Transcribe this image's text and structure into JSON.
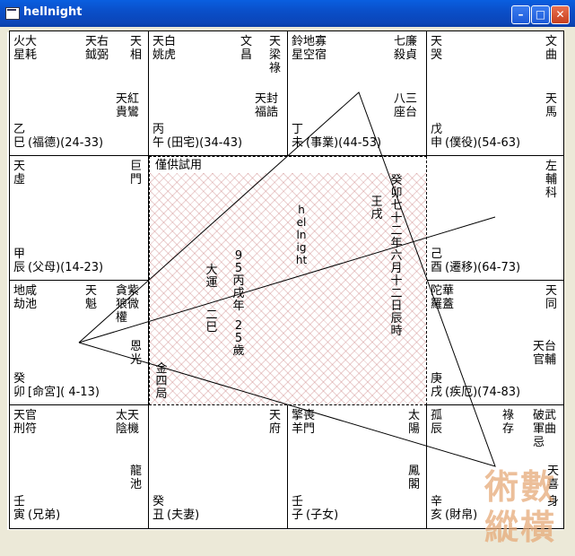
{
  "window": {
    "title": "hellnight"
  },
  "cells": [
    {
      "stars_a": "火大",
      "stars_b": "星耗",
      "stars_c": "天右",
      "stars_d": "鉞弼",
      "stars_e": "天",
      "stars_f": "相",
      "mid": "天紅\n貴鸞",
      "stem": "乙",
      "branch": "巳",
      "label": "(福德)(24-33)"
    },
    {
      "stars_a": "天白",
      "stars_b": "姚虎",
      "stars_c": "文",
      "stars_d": "昌",
      "stars_e": "天",
      "stars_f": "梁\n祿",
      "mid": "天封\n福誥",
      "stem": "丙",
      "branch": "午",
      "label": "(田宅)(34-43)"
    },
    {
      "stars_a": "鈴地寡",
      "stars_b": "星空宿",
      "stars_c": "七廉",
      "stars_d": "殺貞",
      "mid": "八三\n座台",
      "stem": "丁",
      "branch": "未",
      "label": "(事業)(44-53)"
    },
    {
      "stars_a": "天",
      "stars_b": "哭",
      "stars_c": "文",
      "stars_d": "曲",
      "mid": "天\n馬",
      "stem": "戊",
      "branch": "申",
      "label": "(僕役)(54-63)"
    },
    {
      "stars_a": "天",
      "stars_b": "虛",
      "stars_c": "巨",
      "stars_d": "門",
      "stem": "甲",
      "branch": "辰",
      "label": "(父母)(14-23)"
    },
    {
      "stars_a": "左",
      "stars_b": "輔",
      "stars_c": "科",
      "stem": "己",
      "branch": "酉",
      "label": "(遷移)(64-73)"
    },
    {
      "stars_a": "地咸",
      "stars_b": "劫池",
      "stars_c": "天",
      "stars_d": "魁",
      "stars_e": "貪紫",
      "stars_f": "狼微\n權",
      "mid": "恩\n光",
      "stem": "癸",
      "branch": "卯",
      "label": "[命宮]( 4-13)"
    },
    {
      "stars_a": "陀華",
      "stars_b": "羅蓋",
      "stars_c": "天",
      "stars_d": "同",
      "mid": "天台\n官輔",
      "stem": "庚",
      "branch": "戌",
      "label": "(疾厄)(74-83)"
    },
    {
      "stars_a": "天官",
      "stars_b": "刑符",
      "stars_c": "太天",
      "stars_d": "陰機",
      "mid": "龍\n池",
      "stem": "壬",
      "branch": "寅",
      "label": "(兄弟)"
    },
    {
      "stars_a": "天",
      "stars_b": "府",
      "stem": "癸",
      "branch": "丑",
      "label": "(夫妻)"
    },
    {
      "stars_a": "擎喪",
      "stars_b": "羊門",
      "stars_c": "太",
      "stars_d": "陽",
      "mid": "鳳\n閣",
      "stem": "壬",
      "branch": "子",
      "label": "(子女)"
    },
    {
      "stars_a": "孤",
      "stars_b": "辰",
      "stars_c": "祿",
      "stars_d": "存",
      "stars_e": "破武",
      "stars_f": "軍曲\n忌",
      "mid": "天\n喜",
      "side": "身",
      "stem": "辛",
      "branch": "亥",
      "label": "(財帛)"
    }
  ],
  "center": {
    "header": "僅供試用",
    "name_vertical": "hellnight",
    "birth_vertical": "癸卯七十二年六月十二日辰時",
    "year_vertical": "王戌",
    "fortune_col1": "95丙戌年",
    "fortune_col2": "25歲",
    "fortune_col3": "大運",
    "fortune_col4": "二巳",
    "element": "金四局"
  },
  "watermark": "術數縱橫",
  "colors": {
    "titlebar": "#0a5fe0",
    "hatch": "#c87878",
    "watermark": "#e6aa78"
  }
}
